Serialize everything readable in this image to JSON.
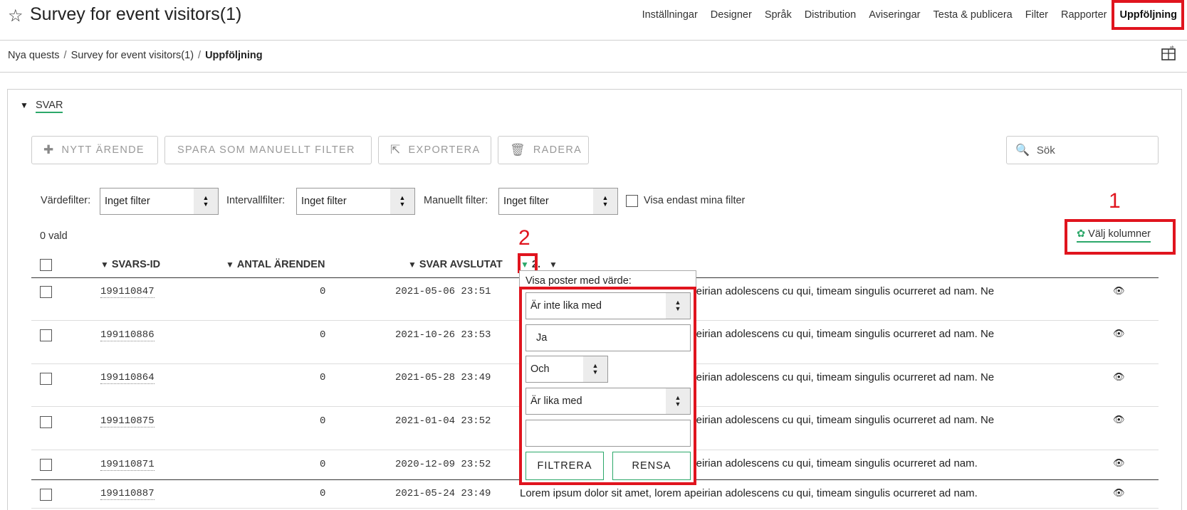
{
  "header": {
    "title": "Survey for event visitors(1)",
    "nav": [
      "Inställningar",
      "Designer",
      "Språk",
      "Distribution",
      "Aviseringar",
      "Testa & publicera",
      "Filter",
      "Rapporter"
    ],
    "nav_active": "Uppföljning"
  },
  "breadcrumb": [
    "Nya quests",
    "Survey for event visitors(1)",
    "Uppföljning"
  ],
  "section": {
    "title": "SVAR"
  },
  "toolbar": {
    "new_case": "NYTT ÄRENDE",
    "save_filter": "SPARA SOM MANUELLT FILTER",
    "export": "EXPORTERA",
    "delete": "RADERA",
    "search_placeholder": "Sök"
  },
  "filters": {
    "value_label": "Värdefilter:",
    "value_selected": "Inget filter",
    "interval_label": "Intervallfilter:",
    "interval_selected": "Inget filter",
    "manual_label": "Manuellt filter:",
    "manual_selected": "Inget filter",
    "only_mine_label": "Visa endast mina filter"
  },
  "selection_count": "0 vald",
  "choose_columns": "Välj kolumner",
  "annotations": {
    "one": "1",
    "two": "2"
  },
  "table": {
    "columns": [
      "SVARS-ID",
      "ANTAL ÄRENDEN",
      "SVAR AVSLUTAT",
      "2."
    ],
    "rows": [
      {
        "id": "199110847",
        "count": "0",
        "date": "2021-05-06 23:51",
        "text": "Lorem ipsum dolor sit amet, lorem apeirian adolescens cu qui, timeam singulis ocurreret ad nam. Ne"
      },
      {
        "id": "199110886",
        "count": "0",
        "date": "2021-10-26 23:53",
        "text": "Lorem ipsum dolor sit amet, lorem apeirian adolescens cu qui, timeam singulis ocurreret ad nam. Ne"
      },
      {
        "id": "199110864",
        "count": "0",
        "date": "2021-05-28 23:49",
        "text": "Lorem ipsum dolor sit amet, lorem apeirian adolescens cu qui, timeam singulis ocurreret ad nam. Ne"
      },
      {
        "id": "199110875",
        "count": "0",
        "date": "2021-01-04 23:52",
        "text": "Lorem ipsum dolor sit amet, lorem apeirian adolescens cu qui, timeam singulis ocurreret ad nam. Ne"
      },
      {
        "id": "199110871",
        "count": "0",
        "date": "2020-12-09 23:52",
        "text": "Lorem ipsum dolor sit amet, lorem apeirian adolescens cu qui, timeam singulis ocurreret ad nam."
      },
      {
        "id": "199110887",
        "count": "0",
        "date": "2021-05-24 23:49",
        "text": "Lorem ipsum dolor sit amet, lorem apeirian adolescens cu qui, timeam singulis ocurreret ad nam."
      }
    ]
  },
  "filter_popup": {
    "title": "Visa poster med värde:",
    "condition1": "Är inte lika med",
    "value1": "Ja",
    "operator": "Och",
    "condition2": "Är lika med",
    "value2": "",
    "filter_button": "FILTRERA",
    "clear_button": "RENSA"
  },
  "colors": {
    "accent": "#2ca86a",
    "highlight": "#e0141e"
  }
}
